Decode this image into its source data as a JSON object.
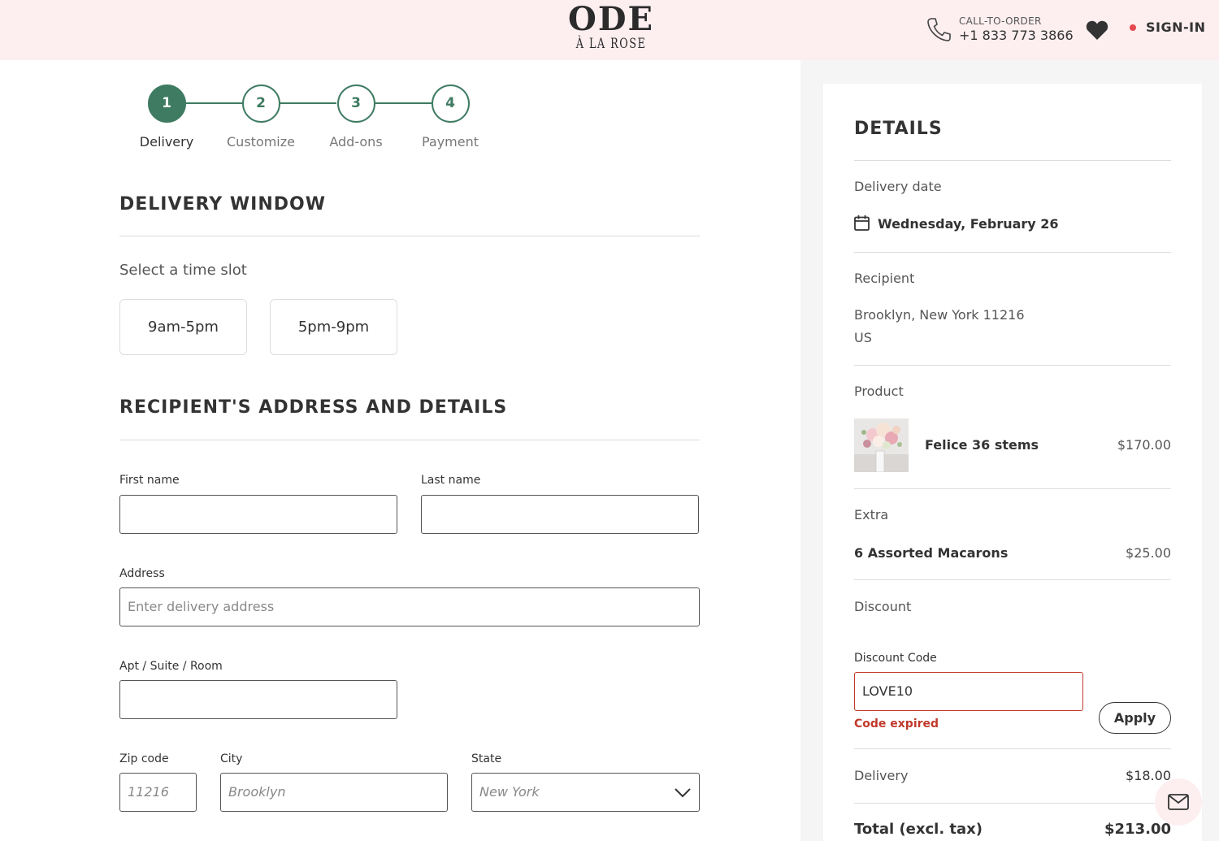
{
  "header": {
    "logo_main": "ODE",
    "logo_sub": "À LA ROSE",
    "call_caption": "CALL-TO-ORDER",
    "phone": "+1 833 773 3866",
    "signin": "SIGN-IN",
    "signin_dot_color": "#e5484d",
    "icons": [
      "phone-icon",
      "heart-icon"
    ],
    "background": "#fdeef0"
  },
  "stepper": {
    "accent": "#3e7b62",
    "active_step": 1,
    "steps": [
      {
        "number": "1",
        "label": "Delivery"
      },
      {
        "number": "2",
        "label": "Customize"
      },
      {
        "number": "3",
        "label": "Add-ons"
      },
      {
        "number": "4",
        "label": "Payment"
      }
    ]
  },
  "delivery_window": {
    "title": "DELIVERY WINDOW",
    "caption": "Select a time slot",
    "slots": [
      "9am-5pm",
      "5pm-9pm"
    ]
  },
  "recipient": {
    "title": "RECIPIENT'S ADDRESS AND DETAILS",
    "first_name": {
      "label": "First name",
      "value": ""
    },
    "last_name": {
      "label": "Last name",
      "value": ""
    },
    "address": {
      "label": "Address",
      "placeholder": "Enter delivery address",
      "value": ""
    },
    "apt": {
      "label": "Apt / Suite / Room",
      "value": ""
    },
    "zip": {
      "label": "Zip code",
      "value": "11216"
    },
    "city": {
      "label": "City",
      "value": "Brooklyn"
    },
    "state": {
      "label": "State",
      "value": "New York"
    }
  },
  "details": {
    "title": "DETAILS",
    "delivery_date_label": "Delivery date",
    "delivery_date": "Wednesday, February 26",
    "recipient_label": "Recipient",
    "recipient_line1": "Brooklyn, New York 11216",
    "recipient_line2": "US",
    "product_label": "Product",
    "product_name": "Felice 36 stems",
    "product_price": "$170.00",
    "extra_label": "Extra",
    "extra_name": "6 Assorted Macarons",
    "extra_price": "$25.00",
    "discount_label": "Discount",
    "discount_code_label": "Discount Code",
    "discount_code_value": "LOVE10",
    "discount_error": "Code expired",
    "discount_error_color": "#c0392b",
    "apply": "Apply",
    "delivery_label": "Delivery",
    "delivery_price": "$18.00",
    "total_label": "Total (excl. tax)",
    "total_value": "$213.00",
    "icons": [
      "calendar-icon",
      "mail-icon"
    ]
  }
}
